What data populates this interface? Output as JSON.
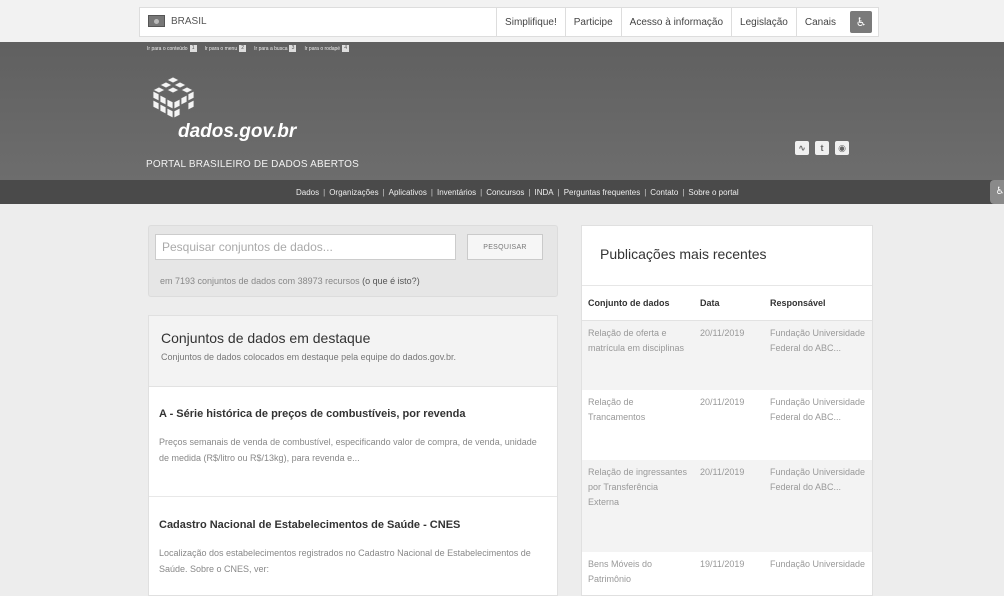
{
  "govbar": {
    "brand": "BRASIL",
    "links": [
      "Simplifique!",
      "Participe",
      "Acesso à informação",
      "Legislação",
      "Canais"
    ]
  },
  "skiplinks": [
    {
      "label": "Ir para o conteúdo",
      "key": "1"
    },
    {
      "label": "Ir para o menu",
      "key": "2"
    },
    {
      "label": "Ir para a busca",
      "key": "3"
    },
    {
      "label": "Ir para o rodapé",
      "key": "4"
    }
  ],
  "header": {
    "site_name": "dados.gov.br",
    "subtitle": "PORTAL BRASILEIRO DE DADOS ABERTOS",
    "social_icons": [
      "rss-icon",
      "twitter-icon",
      "github-icon"
    ]
  },
  "nav": {
    "items": [
      "Dados",
      "Organizações",
      "Aplicativos",
      "Inventários",
      "Concursos",
      "INDA",
      "Perguntas frequentes",
      "Contato",
      "Sobre o portal"
    ]
  },
  "search": {
    "placeholder": "Pesquisar conjuntos de dados...",
    "button_label": "PESQUISAR",
    "stats": "em 7193 conjuntos de dados com 38973 recursos",
    "stats_link": "(o que é isto?)"
  },
  "featured": {
    "title": "Conjuntos de dados em destaque",
    "description": "Conjuntos de dados colocados em destaque pela equipe do dados.gov.br.",
    "items": [
      {
        "title": "A - Série histórica de preços de combustíveis, por revenda",
        "description": "Preços semanais de venda de combustível, especificando valor de compra, de venda, unidade de medida (R$/litro ou R$/13kg), para revenda e..."
      },
      {
        "title": "Cadastro Nacional de Estabelecimentos de Saúde - CNES",
        "description": "Localização dos estabelecimentos registrados no Cadastro Nacional de Estabelecimentos de Saúde. Sobre o CNES, ver:"
      }
    ]
  },
  "publications": {
    "title": "Publicações mais recentes",
    "columns": [
      "Conjunto de dados",
      "Data",
      "Responsável"
    ],
    "rows": [
      {
        "dataset": "Relação de oferta e matrícula em disciplinas",
        "date": "20/11/2019",
        "owner": "Fundação Universidade Federal do ABC..."
      },
      {
        "dataset": "Relação de Trancamentos",
        "date": "20/11/2019",
        "owner": "Fundação Universidade Federal do ABC..."
      },
      {
        "dataset": "Relação de ingressantes por Transferência Externa",
        "date": "20/11/2019",
        "owner": "Fundação Universidade Federal do ABC..."
      },
      {
        "dataset": "Bens Móveis do Patrimônio",
        "date": "19/11/2019",
        "owner": "Fundação Universidade"
      }
    ]
  },
  "colors": {
    "header_bg": "#666666",
    "nav_bg": "#4a4a4a",
    "page_bg": "#ededed"
  }
}
